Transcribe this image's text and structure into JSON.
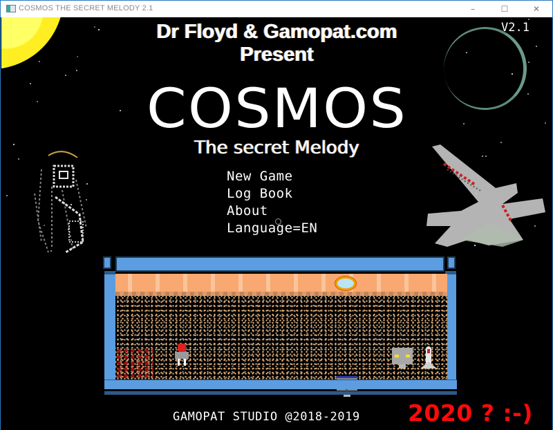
{
  "window": {
    "title": "COSMOS THE SECRET MELODY 2.1",
    "controls": {
      "minimize": "–",
      "maximize": "☐",
      "close": "✕"
    }
  },
  "header": {
    "presenter_line1": "Dr Floyd & Gamopat.com",
    "presenter_line2": "Present",
    "version": "V2.1"
  },
  "logo": {
    "title": "COSMOS",
    "subtitle": "The secret Melody"
  },
  "menu": {
    "items": [
      {
        "label": "New Game"
      },
      {
        "label": "Log Book"
      },
      {
        "label": "About"
      },
      {
        "label": "Language=EN"
      }
    ]
  },
  "preview": {
    "scene": "mars-surface",
    "sprites": [
      "hero-astronaut",
      "robot-grey",
      "robot-blue",
      "rocket"
    ],
    "colors": {
      "frame": "#5b9de0",
      "sky": "#f8a870",
      "ground": "#000000"
    }
  },
  "footer": {
    "copyright": "GAMOPAT STUDIO @2018-2019",
    "annotation": "2020 ? :-)"
  },
  "colors": {
    "annotation": "#ff0a0a",
    "background": "#000000",
    "window_border": "#2b79c2"
  }
}
